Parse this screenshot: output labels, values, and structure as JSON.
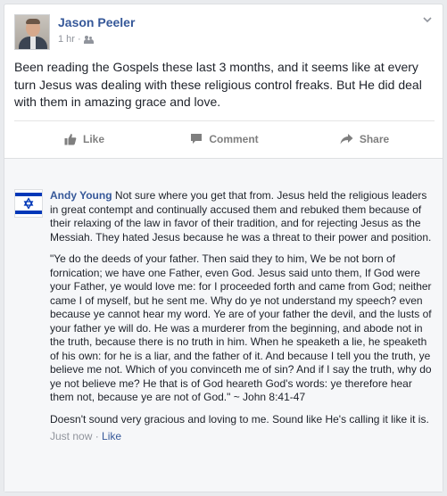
{
  "post": {
    "author": "Jason Peeler",
    "time": "1 hr",
    "separator": "·",
    "audience_icon": "friends-icon",
    "text": "Been reading the Gospels these last 3 months, and it seems like at every turn Jesus was dealing with these religious control freaks. But He did deal with them in amazing grace and love."
  },
  "actions": {
    "like_label": "Like",
    "comment_label": "Comment",
    "share_label": "Share"
  },
  "comment": {
    "author": "Andy Young",
    "paragraph1": "Not sure where you get that from. Jesus held the religious leaders in great contempt and continually accused them and rebuked them because of their relaxing of the law in favor of their tradition, and for rejecting Jesus as the Messiah. They hated Jesus because he was a threat to their power and position.",
    "paragraph2": "\"Ye do the deeds of your father. Then said they to him, We be not born of fornication; we have one Father, even God. Jesus said unto them, If God were your Father, ye would love me: for I proceeded forth and came from God; neither came I of myself, but he sent me. Why do ye not understand my speech? even because ye cannot hear my word. Ye are of your father the devil, and the lusts of your father ye will do. He was a murderer from the beginning, and abode not in the truth, because there is no truth in him. When he speaketh a lie, he speaketh of his own: for he is a liar, and the father of it. And because I tell you the truth, ye believe me not. Which of you convinceth me of sin? And if I say the truth, why do ye not believe me? He that is of God heareth God's words: ye therefore hear them not, because ye are not of God.\" ~ John 8:41-47",
    "paragraph3": "Doesn't sound very gracious and loving to me. Sound like He's calling it like it is.",
    "time": "Just now",
    "separator": "·",
    "like_label": "Like"
  },
  "colors": {
    "link": "#365899",
    "muted": "#90949c",
    "flag_blue": "#0038b8"
  }
}
